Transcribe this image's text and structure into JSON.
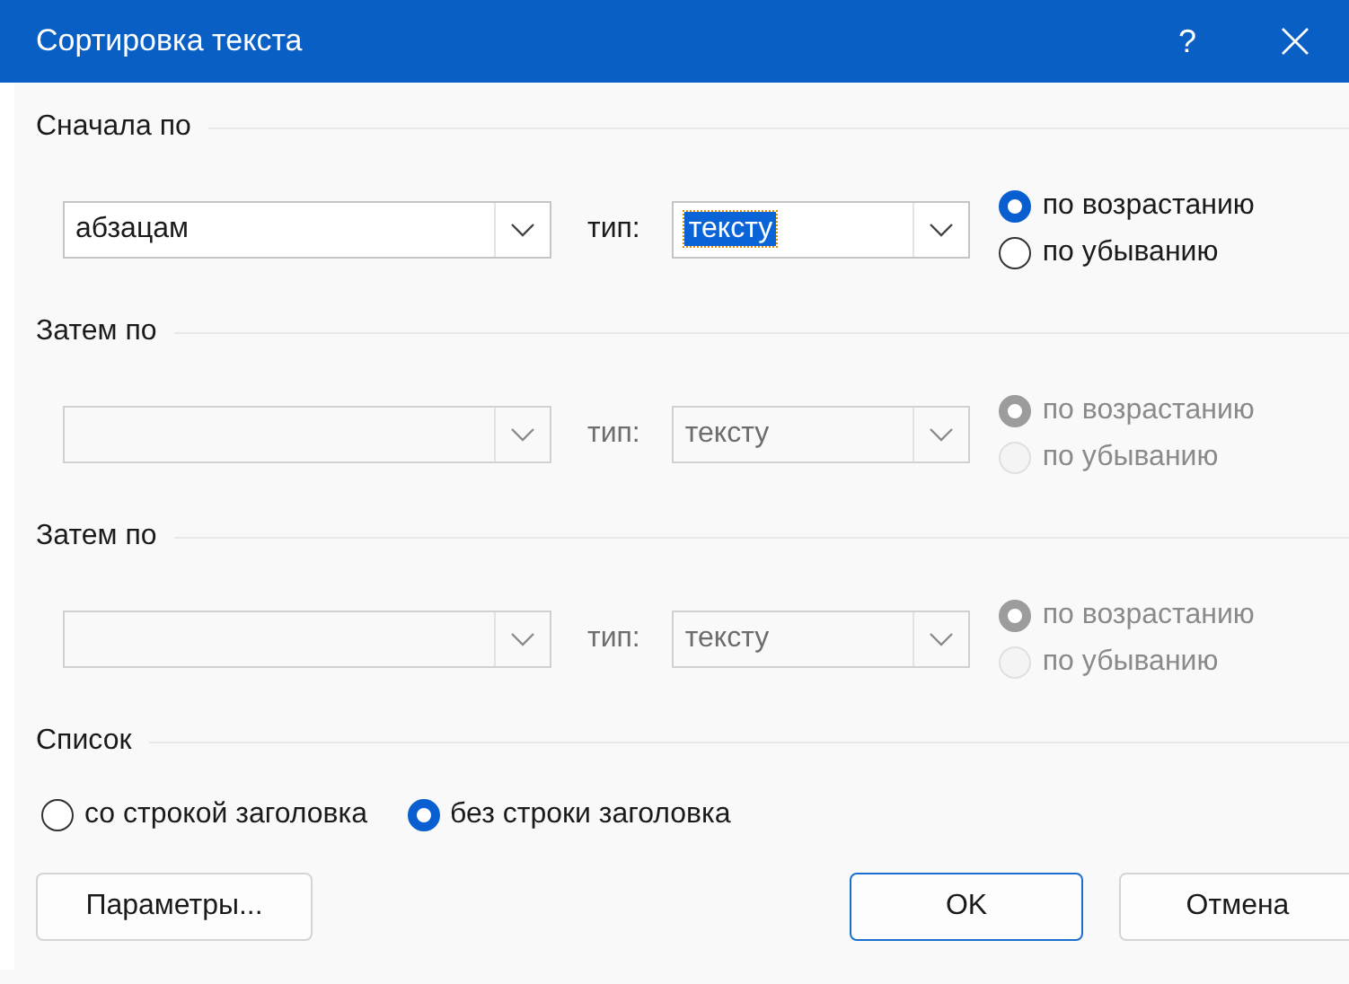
{
  "window": {
    "title": "Сортировка текста",
    "help": "?"
  },
  "sort_keys": [
    {
      "heading": "Сначала по",
      "field": {
        "value": "абзацам"
      },
      "type_label": "тип:",
      "type": {
        "value": "тексту",
        "highlighted": true
      },
      "disabled": false,
      "orders": [
        {
          "label": "по возрастанию",
          "selected": true
        },
        {
          "label": "по убыванию",
          "selected": false
        }
      ]
    },
    {
      "heading": "Затем по",
      "type_label": "тип:",
      "type": {
        "value": "тексту",
        "highlighted": false
      },
      "disabled": true,
      "orders": [
        {
          "label": "по возрастанию",
          "selected": true
        },
        {
          "label": "по убыванию",
          "selected": false
        }
      ]
    },
    {
      "heading": "Затем по",
      "type_label": "тип:",
      "type": {
        "value": "тексту",
        "highlighted": false
      },
      "disabled": true,
      "orders": [
        {
          "label": "по возрастанию",
          "selected": true
        },
        {
          "label": "по убыванию",
          "selected": false
        }
      ]
    }
  ],
  "list": {
    "heading": "Список",
    "options": [
      {
        "label": "со строкой заголовка",
        "selected": false
      },
      {
        "label": "без строки заголовка",
        "selected": true
      }
    ]
  },
  "buttons": [
    {
      "label": "Параметры...",
      "kind": "normal"
    },
    {
      "label": "OK",
      "kind": "default"
    },
    {
      "label": "Отмена",
      "kind": "normal"
    }
  ]
}
